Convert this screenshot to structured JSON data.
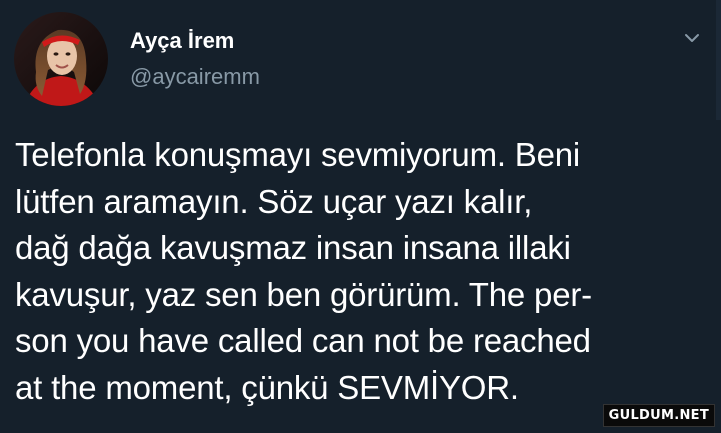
{
  "tweet": {
    "display_name": "Ayça İrem",
    "handle": "@aycairemm",
    "text_lines": [
      "Telefonla konuşmayı sevmiyorum. Beni",
      "lütfen aramayın. Söz uçar yazı kalır,",
      "dağ dağa kavuşmaz insan insana illaki",
      "kavuşur, yaz sen ben görürüm. The per-",
      "son you have called can not be reached",
      "at the moment, çünkü SEVMİYOR."
    ],
    "menu_icon": "chevron-down-icon"
  },
  "watermark": {
    "text": "GULDUM.NET"
  },
  "colors": {
    "background": "#15202b",
    "text_primary": "#ffffff",
    "text_secondary": "#8899a6"
  }
}
